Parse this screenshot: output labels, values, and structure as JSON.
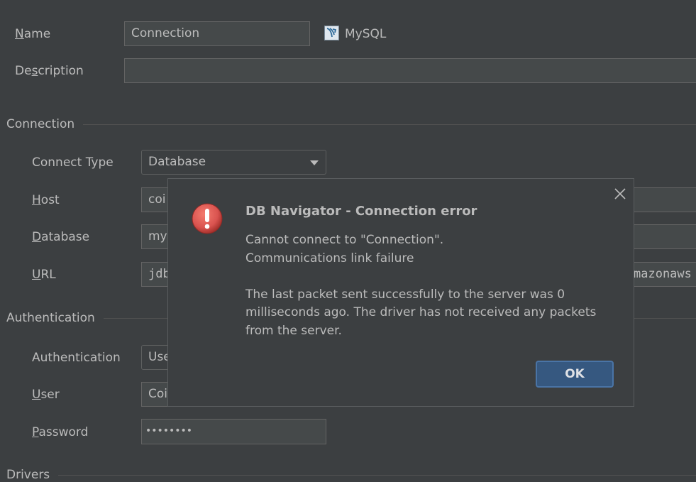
{
  "form": {
    "name_label_mn": "N",
    "name_label_rest": "ame",
    "name_value": "Connection",
    "db_type": "MySQL",
    "db_type_icon": "mysql-dolphin-icon",
    "description_label_pre": "De",
    "description_label_mn": "s",
    "description_label_rest": "cription",
    "description_value": ""
  },
  "connection": {
    "section_title": "Connection",
    "connect_type_label": "Connect Type",
    "connect_type_value": "Database",
    "host_label_mn": "H",
    "host_label_rest": "ost",
    "host_value": "coi",
    "host_value_tail": "",
    "database_label_mn": "D",
    "database_label_rest": "atabase",
    "database_value": "my",
    "url_label_mn": "U",
    "url_label_rest": "RL",
    "url_value": "jdb",
    "url_value_tail": "mazonaws"
  },
  "authentication": {
    "section_title": "Authentication",
    "auth_label": "Authentication",
    "auth_value": "Use",
    "user_label_mn": "U",
    "user_label_rest": "ser",
    "user_value": "Coi",
    "password_label_mn": "P",
    "password_label_rest": "assword",
    "password_value": "••••••••"
  },
  "drivers": {
    "section_title": "Drivers"
  },
  "dialog": {
    "title": "DB Navigator - Connection error",
    "message_line1": "Cannot connect to \"Connection\".",
    "message_line2": "Communications link failure",
    "message_body": "The last packet sent successfully to the server was 0 milliseconds ago. The driver has not received any packets from the server.",
    "ok_label": "OK",
    "error_icon": "error-exclamation-icon",
    "close_icon": "close-icon"
  },
  "colors": {
    "background": "#3c3f41",
    "field": "#45494a",
    "text": "#bbbbbb",
    "ok_button": "#365880",
    "error_red": "#d9534f"
  }
}
